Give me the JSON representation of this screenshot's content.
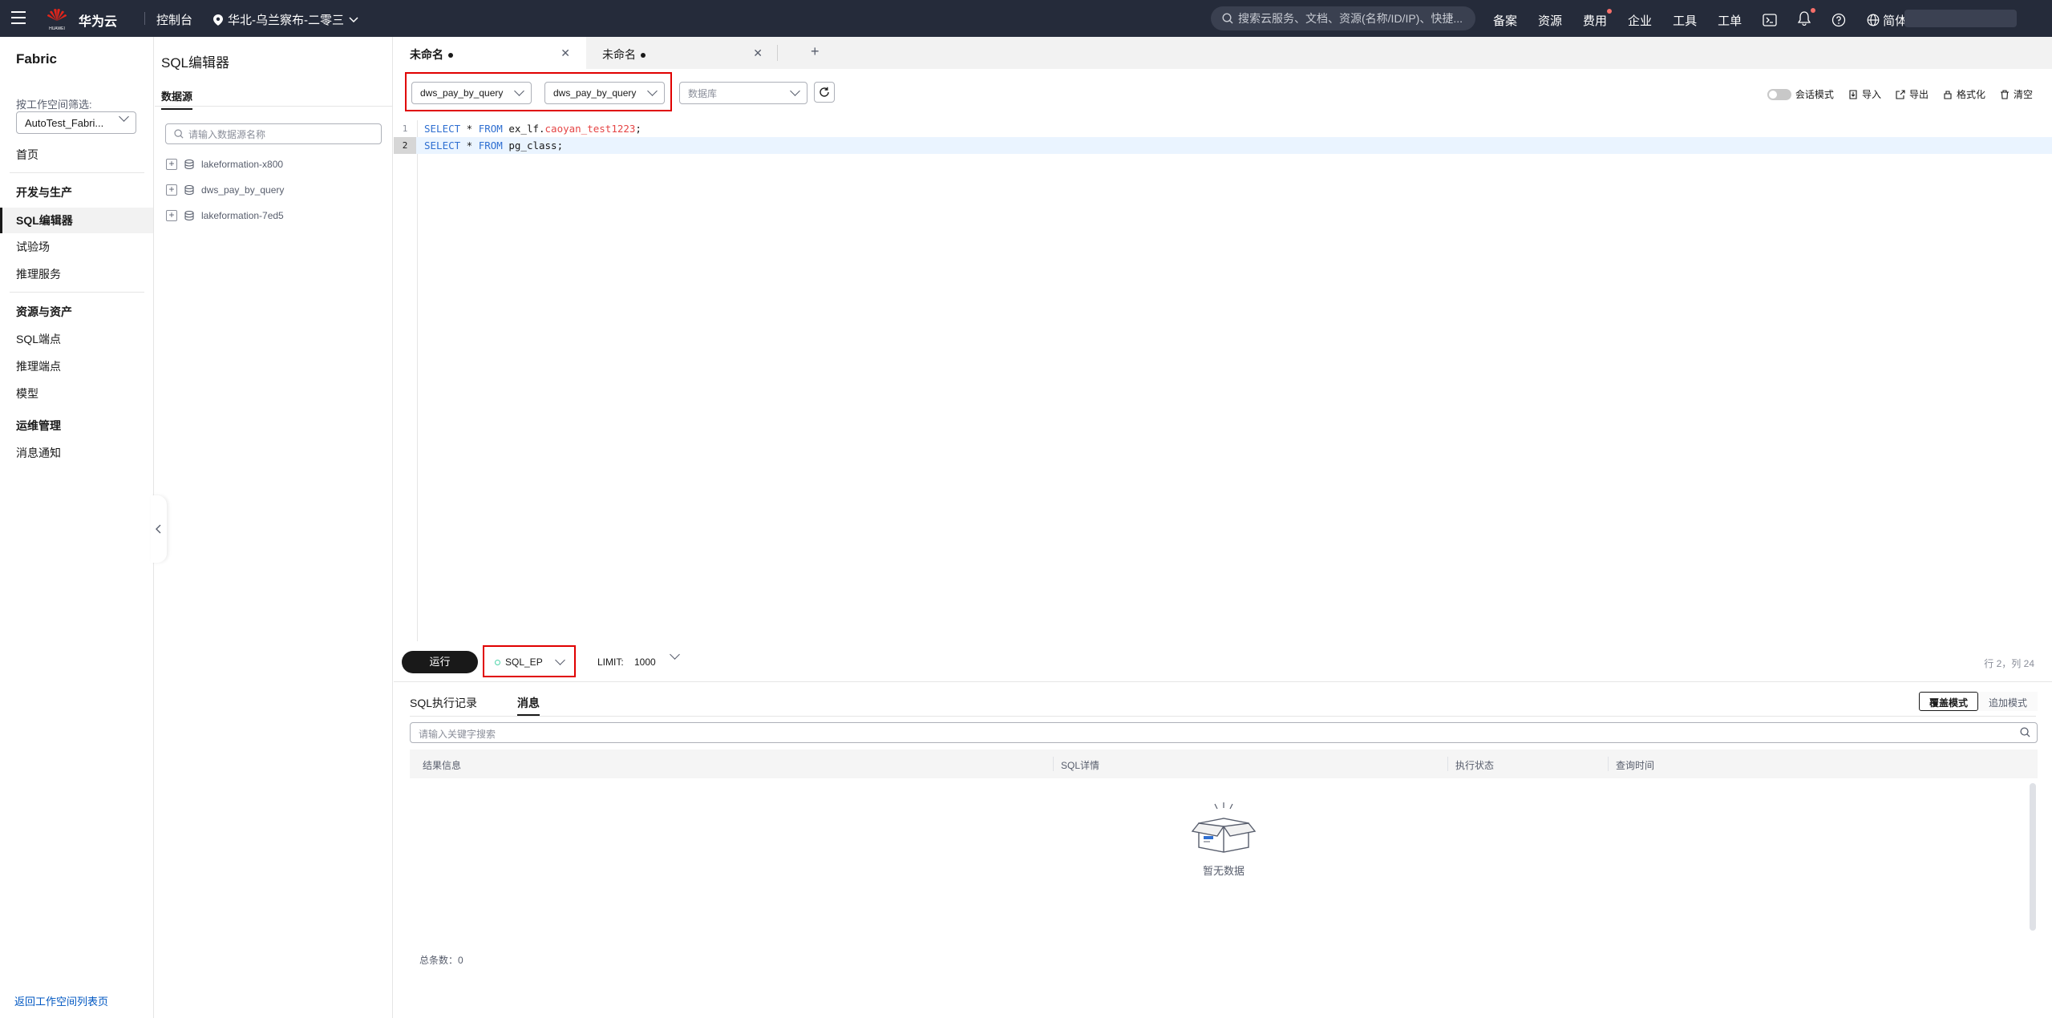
{
  "topbar": {
    "brand": "华为云",
    "logo_text": "HUAWEI",
    "console": "控制台",
    "region": "华北-乌兰察布-二零三",
    "search_placeholder": "搜索云服务、文档、资源(名称/ID/IP)、快捷...",
    "links": [
      "备案",
      "资源",
      "费用",
      "企业",
      "工具",
      "工单"
    ],
    "language": "简体"
  },
  "leftnav": {
    "title": "Fabric",
    "filter_label": "按工作空间筛选:",
    "workspace": "AutoTest_Fabri...",
    "home": "首页",
    "group_dev": "开发与生产",
    "sql_editor": "SQL编辑器",
    "playground": "试验场",
    "inference_service": "推理服务",
    "group_resources": "资源与资产",
    "sql_endpoint": "SQL端点",
    "inference_endpoint": "推理端点",
    "model": "模型",
    "group_ops": "运维管理",
    "notifications": "消息通知",
    "back_link": "返回工作空间列表页"
  },
  "datasource_panel": {
    "title": "SQL编辑器",
    "tab": "数据源",
    "search_placeholder": "请输入数据源名称",
    "items": [
      "lakeformation-x800",
      "dws_pay_by_query",
      "lakeformation-7ed5"
    ]
  },
  "editor": {
    "tabs": [
      {
        "label": "未命名",
        "dirty": true
      },
      {
        "label": "未命名",
        "dirty": true
      }
    ],
    "datasource_select": "dws_pay_by_query",
    "catalog_select": "dws_pay_by_query",
    "database_placeholder": "数据库",
    "tools": {
      "session_mode": "会话模式",
      "import": "导入",
      "export": "导出",
      "format": "格式化",
      "clear": "清空"
    },
    "lines": [
      {
        "num": "1",
        "kw1": "SELECT",
        "mid1": " * ",
        "kw2": "FROM",
        "rest_plain": " ex_lf.",
        "rest_str": "caoyan_test1223",
        "tail": ";"
      },
      {
        "num": "2",
        "kw1": "SELECT",
        "mid1": " * ",
        "kw2": "FROM",
        "rest_plain": " pg_class;",
        "rest_str": "",
        "tail": ""
      }
    ],
    "run_label": "运行",
    "endpoint": "SQL_EP",
    "limit_label": "LIMIT:",
    "limit_value": "1000",
    "cursor_pos": "行 2，列 24"
  },
  "results": {
    "tab_history": "SQL执行记录",
    "tab_messages": "消息",
    "mode_overwrite": "覆盖模式",
    "mode_append": "追加模式",
    "search_placeholder": "请输入关键字搜索",
    "columns": [
      "结果信息",
      "SQL详情",
      "执行状态",
      "查询时间"
    ],
    "empty_text": "暂无数据",
    "total": "总条数：0"
  },
  "colors": {
    "topbar_bg": "#252b3a",
    "keyword": "#2f6fd1",
    "string": "#e54545",
    "highlight_box": "#e00000",
    "status_dot": "#50d4ab"
  }
}
